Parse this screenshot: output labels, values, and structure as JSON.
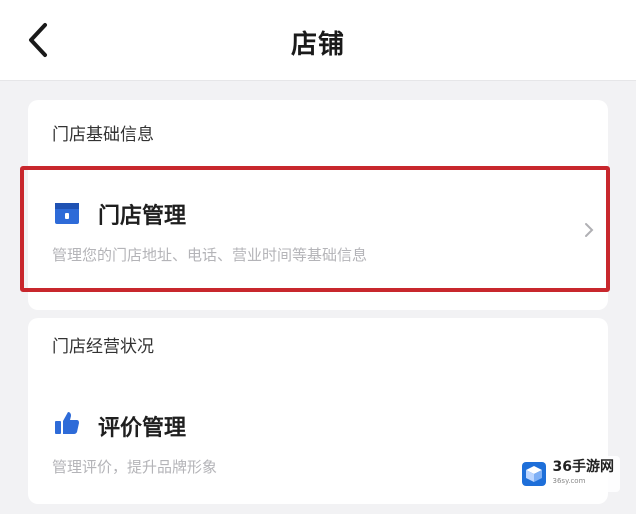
{
  "header": {
    "title": "店铺",
    "back_icon": "chevron-left-icon"
  },
  "sections": [
    {
      "label": "门店基础信息",
      "items": [
        {
          "title": "门店管理",
          "description": "管理您的门店地址、电话、营业时间等基础信息",
          "icon": "store-icon",
          "highlighted": true
        }
      ]
    },
    {
      "label": "门店经营状况",
      "items": [
        {
          "title": "评价管理",
          "description": "管理评价，提升品牌形象",
          "icon": "thumbs-up-icon",
          "highlighted": false
        }
      ]
    }
  ],
  "watermark": {
    "main": "36手游网",
    "sub": "36sy.com"
  },
  "colors": {
    "accent_blue": "#2e6bd8",
    "highlight_red": "#c8272d",
    "background": "#f2f2f4"
  }
}
